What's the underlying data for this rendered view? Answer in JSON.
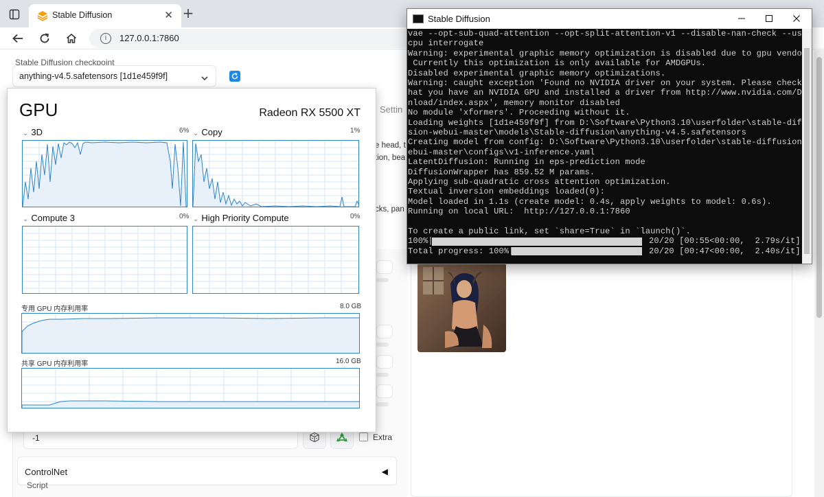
{
  "browser": {
    "tab_title": "Stable Diffusion",
    "new_tab": "+",
    "close_tab": "✕",
    "url": "127.0.0.1:7860"
  },
  "webui": {
    "checkpoint_label": "Stable Diffusion checkpoint",
    "checkpoint_value": "anything-v4.5.safetensors [1d1e459f9f]",
    "settings_tab_fragment": "Settin",
    "prompt_fragment_1": "e head, t",
    "prompt_fragment_2": "tion, bea",
    "neg_fragment": "cks, pan",
    "seed_value": "-1",
    "extra_label": "Extra",
    "controlnet_label": "ControlNet",
    "controlnet_toggle": "◀",
    "script_label": "Script",
    "accent_color": "#1e88e5"
  },
  "gpu_panel": {
    "title": "GPU",
    "model": "Radeon RX 5500 XT",
    "engines": [
      {
        "label": "3D",
        "percent": "6%"
      },
      {
        "label": "Copy",
        "percent": "1%"
      },
      {
        "label": "Compute 3",
        "percent": "0%"
      },
      {
        "label": "High Priority Compute",
        "percent": "0%"
      }
    ],
    "dedicated_memory_label": "专用 GPU 内存利用率",
    "dedicated_memory_value": "8.0 GB",
    "shared_memory_label": "共享 GPU 内存利用率",
    "shared_memory_value": "16.0 GB",
    "graph_color": "#2e84c9"
  },
  "console": {
    "title": "Stable Diffusion",
    "lines": [
      "vae --opt-sub-quad-attention --opt-split-attention-v1 --disable-nan-check --use-",
      "cpu interrogate",
      "Warning: experimental graphic memory optimization is disabled due to gpu vendor.",
      " Currently this optimization is only available for AMDGPUs.",
      "Disabled experimental graphic memory optimizations.",
      "Warning: caught exception 'Found no NVIDIA driver on your system. Please check t",
      "hat you have an NVIDIA GPU and installed a driver from http://www.nvidia.com/Dow",
      "nload/index.aspx', memory monitor disabled",
      "No module 'xformers'. Proceeding without it.",
      "Loading weights [1d1e459f9f] from D:\\Software\\Python3.10\\userfolder\\stable-diffu",
      "sion-webui-master\\models\\Stable-diffusion\\anything-v4.5.safetensors",
      "Creating model from config: D:\\Software\\Python3.10\\userfolder\\stable-diffusion-w",
      "ebui-master\\configs\\v1-inference.yaml",
      "LatentDiffusion: Running in eps-prediction mode",
      "DiffusionWrapper has 859.52 M params.",
      "Applying sub-quadratic cross attention optimization.",
      "Textual inversion embeddings loaded(0):",
      "Model loaded in 1.1s (create model: 0.4s, apply weights to model: 0.6s).",
      "Running on local URL:  http://127.0.0.1:7860",
      "",
      "To create a public link, set `share=True` in `launch()`.",
      "100%|",
      "Total progress: 100%|"
    ],
    "progress_1_stats": "20/20 [00:55<00:00,  2.79s/it]",
    "progress_2_stats": "20/20 [00:47<00:00,  2.40s/it]",
    "progress_1_fraction": 1.0,
    "progress_2_fraction": 1.0
  }
}
